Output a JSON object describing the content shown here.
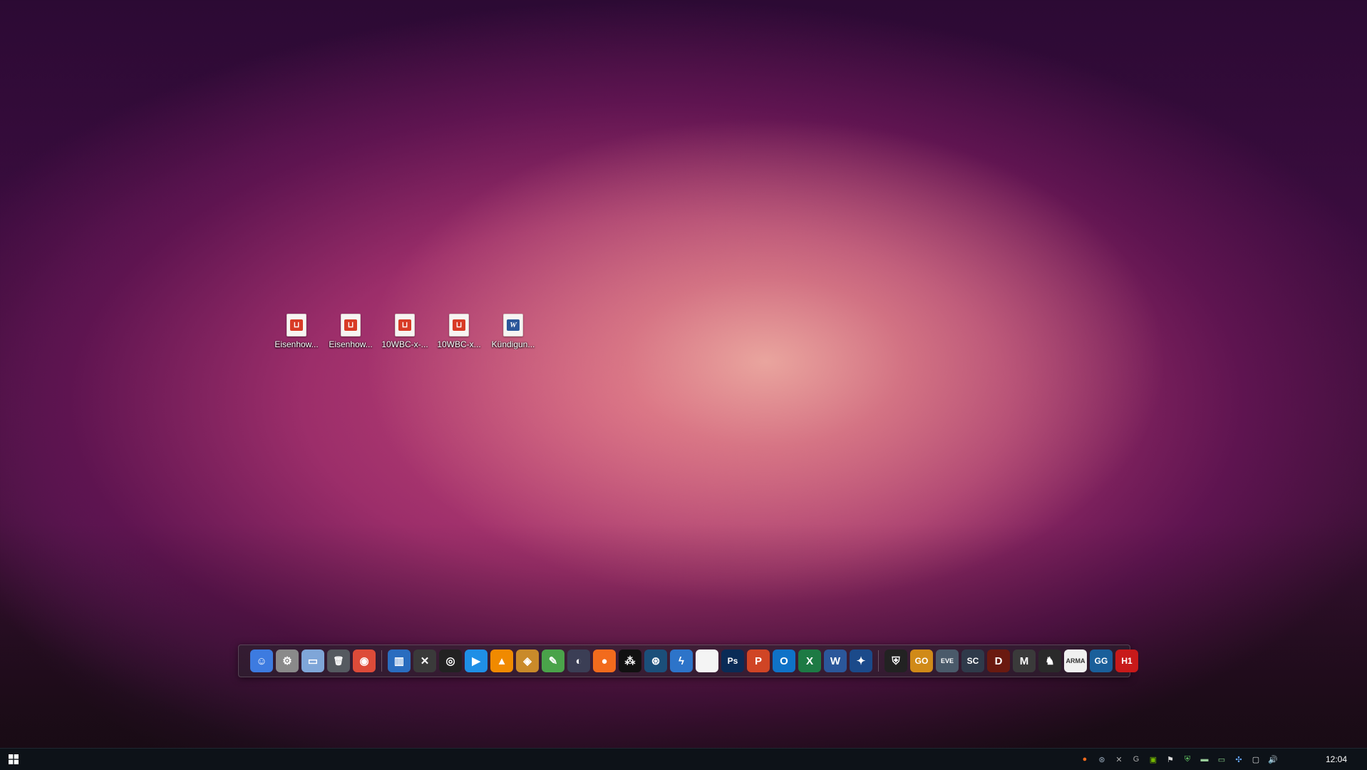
{
  "desktop": {
    "icons": [
      {
        "label": "Eisenhow...",
        "type": "pdf"
      },
      {
        "label": "Eisenhow...",
        "type": "pdf"
      },
      {
        "label": "10WBC-x-...",
        "type": "pdf"
      },
      {
        "label": "10WBC-x...",
        "type": "pdf"
      },
      {
        "label": "Kündigun...",
        "type": "word"
      }
    ]
  },
  "dock": {
    "items": [
      {
        "name": "finder-icon",
        "glyph": "☺",
        "color": "#3d7be0"
      },
      {
        "name": "system-preferences-icon",
        "glyph": "⚙",
        "color": "#8a8a8a"
      },
      {
        "name": "folder-icon",
        "glyph": "▭",
        "color": "#7fa6d8"
      },
      {
        "name": "trash-icon",
        "glyph": "🗑",
        "color": "#555a60"
      },
      {
        "name": "chrome-icon",
        "glyph": "◉",
        "color": "#dd4b39"
      },
      {
        "sep": true
      },
      {
        "name": "audio-mixer-icon",
        "glyph": "▥",
        "color": "#2a6dbf"
      },
      {
        "name": "x-app-icon",
        "glyph": "✕",
        "color": "#3a3a3a"
      },
      {
        "name": "obs-icon",
        "glyph": "◎",
        "color": "#222"
      },
      {
        "name": "play-icon",
        "glyph": "▶",
        "color": "#1f8fe6"
      },
      {
        "name": "vlc-icon",
        "glyph": "▲",
        "color": "#f08a00"
      },
      {
        "name": "owl-app-icon",
        "glyph": "◈",
        "color": "#c98a2a"
      },
      {
        "name": "image-editor-icon",
        "glyph": "✎",
        "color": "#4aa34a"
      },
      {
        "name": "audio-app-icon",
        "glyph": "◐",
        "color": "#3b3e55"
      },
      {
        "name": "origin-icon",
        "glyph": "●",
        "color": "#f26b1d"
      },
      {
        "name": "blackberry-icon",
        "glyph": "⁂",
        "color": "#111"
      },
      {
        "name": "steam-icon",
        "glyph": "⊛",
        "color": "#1b4f7a"
      },
      {
        "name": "lightning-app-icon",
        "glyph": "ϟ",
        "color": "#2d74c9"
      },
      {
        "name": "blank-document-icon",
        "glyph": "",
        "color": "#f4f4f4"
      },
      {
        "name": "photoshop-icon",
        "glyph": "Ps",
        "color": "#0a2b56"
      },
      {
        "name": "powerpoint-icon",
        "glyph": "P",
        "color": "#d04525"
      },
      {
        "name": "outlook-icon",
        "glyph": "O",
        "color": "#0f72c7"
      },
      {
        "name": "excel-icon",
        "glyph": "X",
        "color": "#1d7a44"
      },
      {
        "name": "word-icon",
        "glyph": "W",
        "color": "#2b579a"
      },
      {
        "name": "battlenet-icon",
        "glyph": "✦",
        "color": "#1b4a8a"
      },
      {
        "sep": true
      },
      {
        "name": "game-shield-icon",
        "glyph": "⛨",
        "color": "#222"
      },
      {
        "name": "csgo-icon",
        "glyph": "GO",
        "color": "#d08a18"
      },
      {
        "name": "eve-icon",
        "glyph": "EVE",
        "color": "#4a5a6a"
      },
      {
        "name": "starcraft-icon",
        "glyph": "SC",
        "color": "#2f3a4a"
      },
      {
        "name": "diablo-icon",
        "glyph": "D",
        "color": "#6a1a10"
      },
      {
        "name": "m-game-icon",
        "glyph": "M",
        "color": "#3a3a3a"
      },
      {
        "name": "knight-game-icon",
        "glyph": "♞",
        "color": "#2a2a2a"
      },
      {
        "name": "arma-icon",
        "glyph": "ARMA",
        "color": "#f0f0f0"
      },
      {
        "name": "gg-icon",
        "glyph": "GG",
        "color": "#1a5f9a"
      },
      {
        "name": "h1z1-icon",
        "glyph": "H1",
        "color": "#c81a1a"
      }
    ]
  },
  "taskbar": {
    "tray": [
      {
        "name": "origin-tray-icon",
        "glyph": "●",
        "color": "#f26b1d"
      },
      {
        "name": "steam-tray-icon",
        "glyph": "⊛",
        "color": "#9ab"
      },
      {
        "name": "x-tray-icon",
        "glyph": "✕",
        "color": "#aaa"
      },
      {
        "name": "g-tray-icon",
        "glyph": "G",
        "color": "#aaa"
      },
      {
        "name": "nvidia-tray-icon",
        "glyph": "▣",
        "color": "#76b900"
      },
      {
        "name": "flag-tray-icon",
        "glyph": "⚑",
        "color": "#ddd"
      },
      {
        "name": "security-tray-icon",
        "glyph": "⛨",
        "color": "#6c6"
      },
      {
        "name": "chat-tray-icon",
        "glyph": "▬",
        "color": "#9c9"
      },
      {
        "name": "battery-tray-icon",
        "glyph": "▭",
        "color": "#8c8"
      },
      {
        "name": "network-activity-tray-icon",
        "glyph": "✣",
        "color": "#6af"
      },
      {
        "name": "network-tray-icon",
        "glyph": "▢",
        "color": "#ddd"
      },
      {
        "name": "volume-tray-icon",
        "glyph": "🔊",
        "color": "#ddd"
      }
    ],
    "clock": "12:04"
  }
}
